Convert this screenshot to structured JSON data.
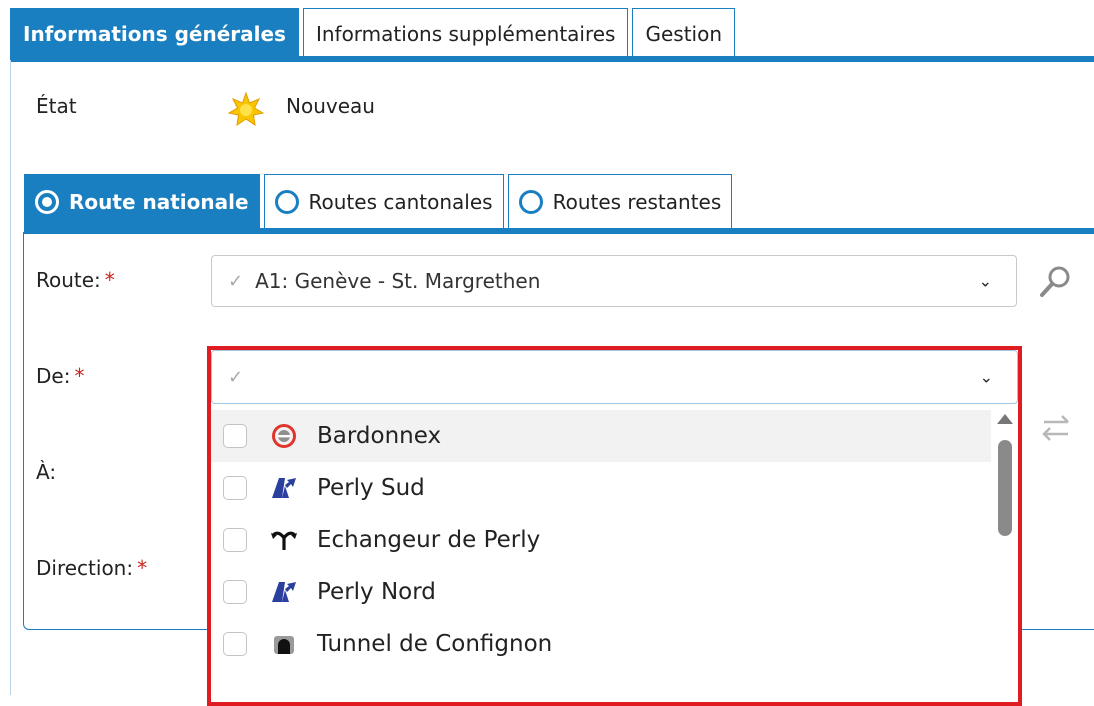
{
  "top_tabs": [
    {
      "label": "Informations générales",
      "active": true
    },
    {
      "label": "Informations supplémentaires",
      "active": false
    },
    {
      "label": "Gestion",
      "active": false
    }
  ],
  "etat": {
    "label": "État",
    "icon": "new-star-icon",
    "value": "Nouveau"
  },
  "route_tabs": [
    {
      "label": "Route nationale",
      "active": true
    },
    {
      "label": "Routes cantonales",
      "active": false
    },
    {
      "label": "Routes restantes",
      "active": false
    }
  ],
  "form": {
    "route": {
      "label": "Route:",
      "required_mark": "*",
      "value": "A1: Genève - St. Margrethen"
    },
    "de": {
      "label": "De:",
      "required_mark": "*",
      "value": ""
    },
    "a": {
      "label": "À:"
    },
    "direction": {
      "label": "Direction:",
      "required_mark": "*"
    }
  },
  "dropdown": {
    "items": [
      {
        "label": "Bardonnex",
        "icon": "customs-icon",
        "highlighted": true
      },
      {
        "label": "Perly Sud",
        "icon": "junction-icon",
        "highlighted": false
      },
      {
        "label": "Echangeur de Perly",
        "icon": "interchange-icon",
        "highlighted": false
      },
      {
        "label": "Perly Nord",
        "icon": "junction-icon",
        "highlighted": false
      },
      {
        "label": "Tunnel de Confignon",
        "icon": "tunnel-icon",
        "highlighted": false
      }
    ]
  },
  "colors": {
    "accent": "#1a7fc1",
    "required": "#d0211c",
    "highlight_frame": "#e11b22"
  }
}
